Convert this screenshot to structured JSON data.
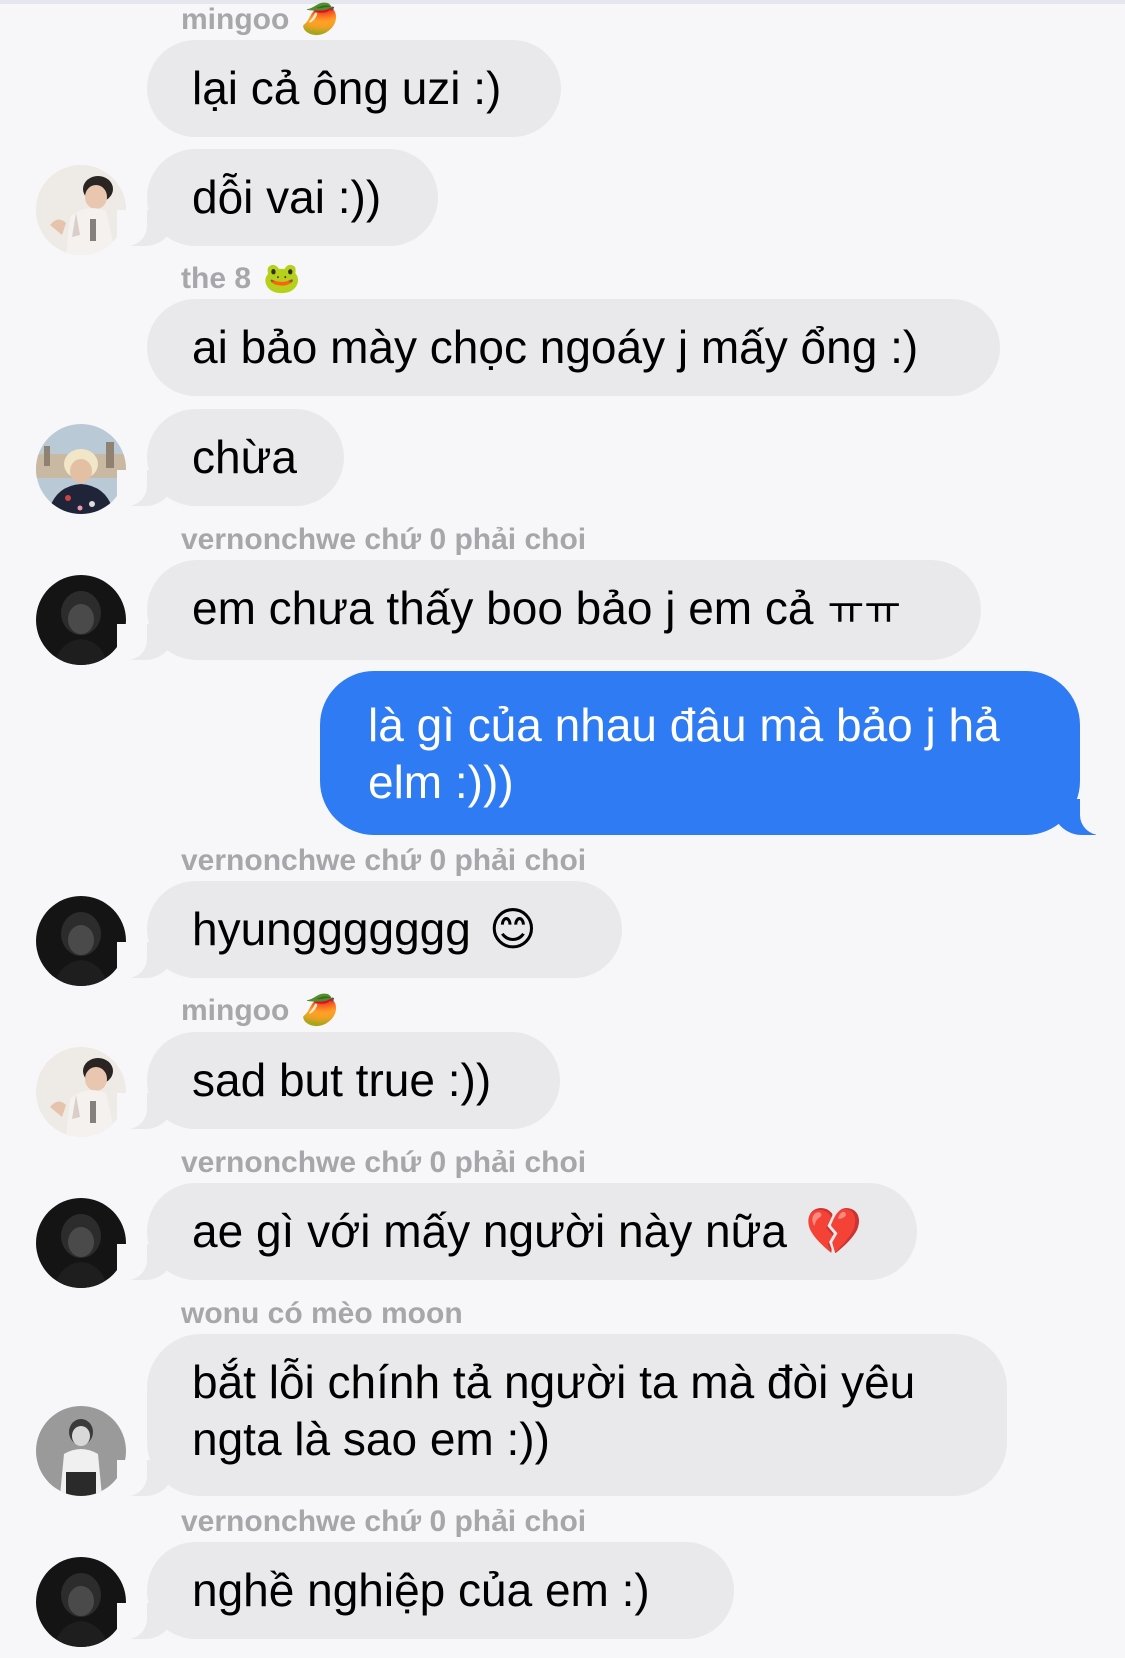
{
  "chat": {
    "messages": [
      {
        "sender": "mingoo",
        "sender_emoji": "🥭",
        "text": "lại cả ông uzi :)",
        "direction": "incoming"
      },
      {
        "text": "dỗi vai :))",
        "direction": "incoming",
        "avatar": "avatar-mingoo"
      },
      {
        "sender": "the 8",
        "sender_emoji": "🐸",
        "text": "ai bảo mày chọc ngoáy j mấy ổng :)",
        "direction": "incoming"
      },
      {
        "text": "chừa",
        "direction": "incoming",
        "avatar": "avatar-the8"
      },
      {
        "sender": "vernonchwe chứ 0 phải choi",
        "text": "em chưa thấy boo bảo j em cả",
        "emoji": "ㅠㅠ",
        "direction": "incoming",
        "avatar": "avatar-vernon"
      },
      {
        "text": "là gì của nhau đâu mà bảo j hả elm :)))",
        "direction": "outgoing"
      },
      {
        "sender": "vernonchwe chứ 0 phải choi",
        "text": "hyunggggggg",
        "emoji": "😊",
        "direction": "incoming",
        "avatar": "avatar-vernon"
      },
      {
        "sender": "mingoo",
        "sender_emoji": "🥭",
        "text": "sad but true :))",
        "direction": "incoming",
        "avatar": "avatar-mingoo"
      },
      {
        "sender": "vernonchwe chứ 0 phải choi",
        "text": "ae gì với mấy người này nữa",
        "emoji": "💔",
        "direction": "incoming",
        "avatar": "avatar-vernon"
      },
      {
        "sender": "wonu có mèo moon",
        "text": "bắt lỗi chính tả người ta mà đòi yêu ngta là sao em :))",
        "direction": "incoming",
        "avatar": "avatar-wonu"
      },
      {
        "sender": "vernonchwe chứ 0 phải choi",
        "text": "nghề nghiệp của em :)",
        "direction": "incoming",
        "avatar": "avatar-vernon"
      }
    ]
  },
  "colors": {
    "background": "#f7f7f9",
    "incoming_bubble": "#e9e9eb",
    "outgoing_bubble": "#2f7bf3",
    "sender_label": "#a6a6ab"
  }
}
